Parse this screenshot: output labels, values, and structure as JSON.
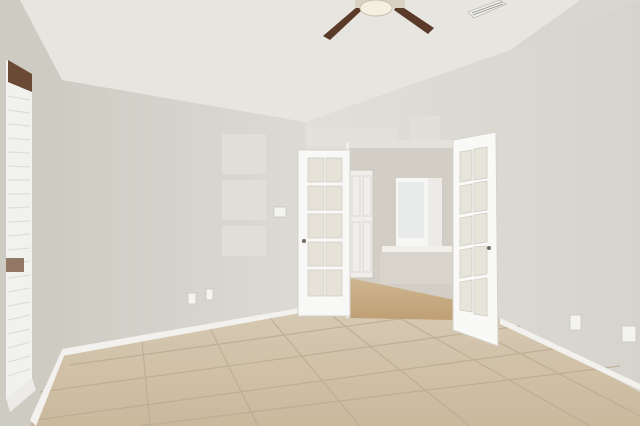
{
  "scene": {
    "description_kind": "photo-interior-empty-room",
    "colors": {
      "ceiling": "#ebeae6",
      "wall_left": "#d3d1ca",
      "wall_back": "#d8d6cf",
      "wall_right": "#dddbd5",
      "floor": "#cfc0a8",
      "grout": "#b8a98f",
      "baseboard": "#f4f3ef",
      "door": "#f7f7f4",
      "glass": "#e9e6dd",
      "fan_blade": "#5a3a28",
      "hall_floor": "#c8ad86",
      "window_light": "#f3f3f1"
    },
    "objects": {
      "fan": "ceiling-fan-icon",
      "vent": "air-vent-icon",
      "left_window": "window-blinds-icon",
      "french_doors": "french-door-icon",
      "outlets": "outlet-icon",
      "switch": "light-switch-icon"
    }
  }
}
